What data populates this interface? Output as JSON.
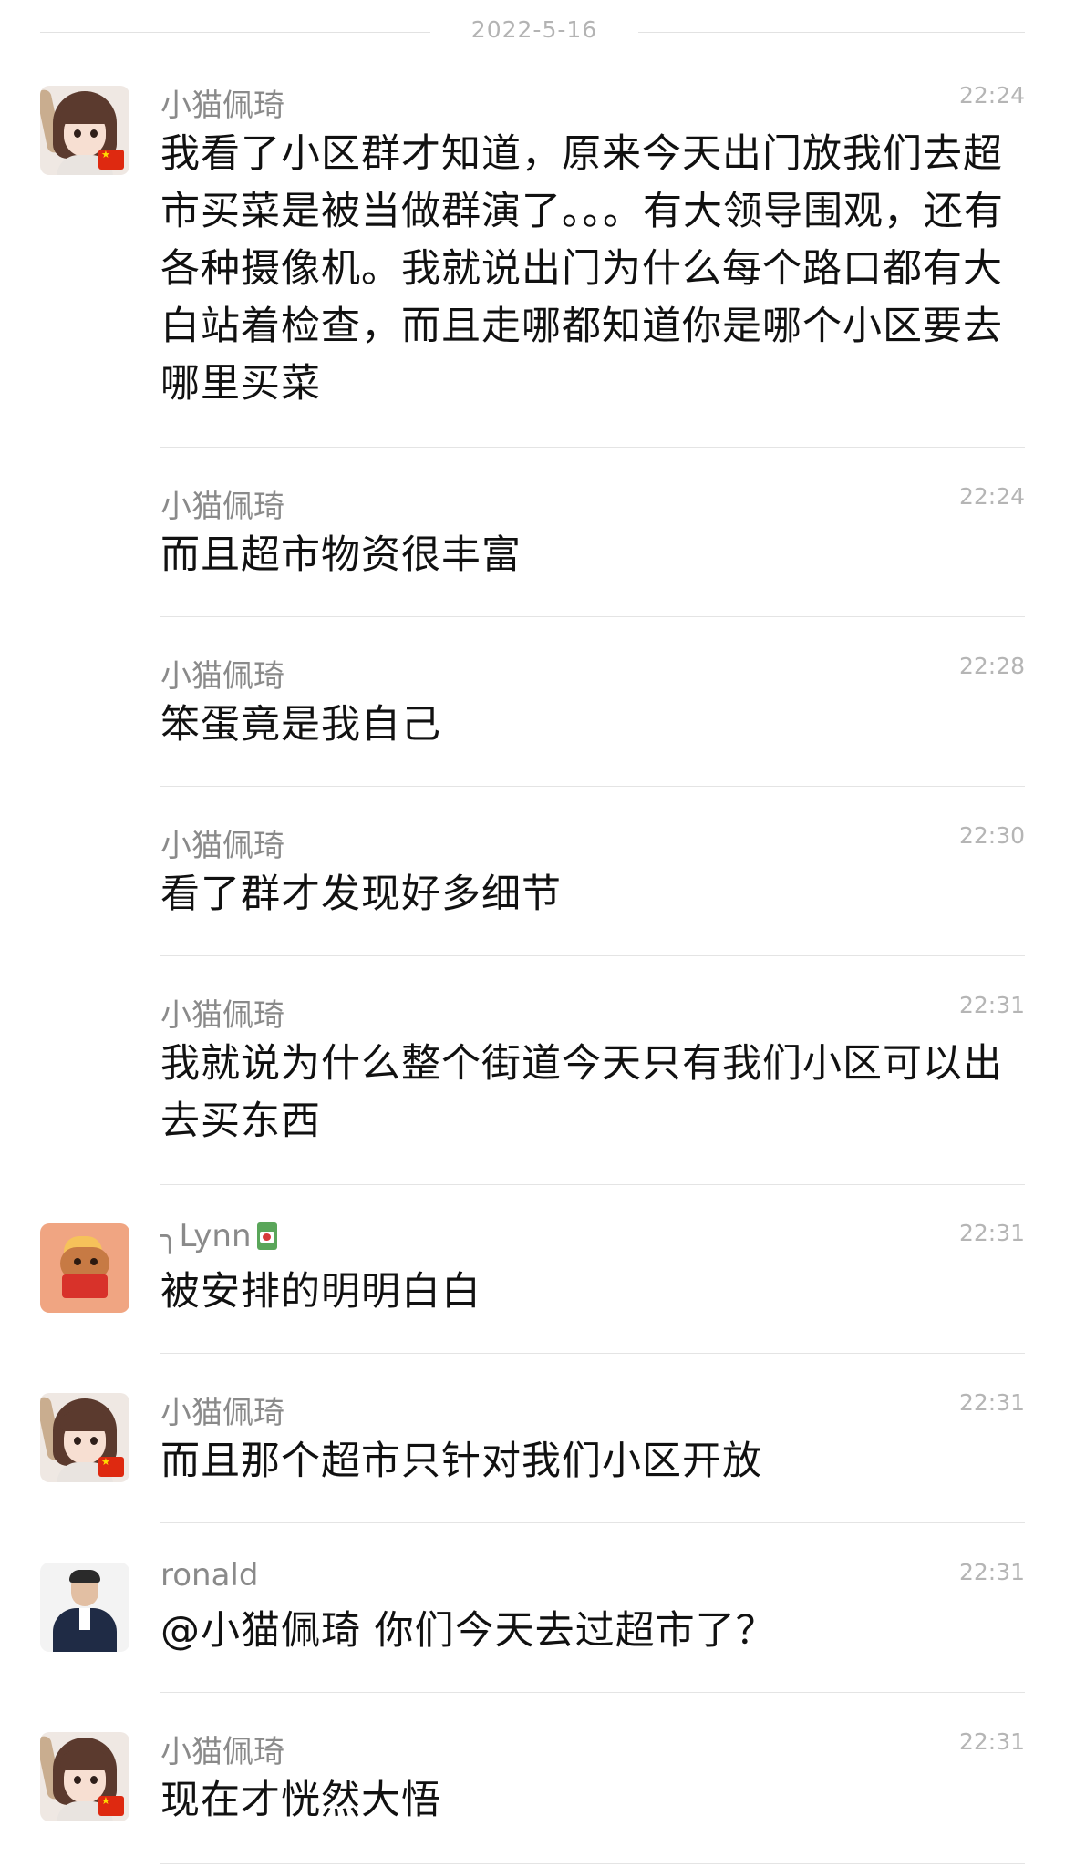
{
  "date_divider": "2022-5-16",
  "messages": [
    {
      "sender": "小猫佩琦",
      "time": "22:24",
      "content": "我看了小区群才知道，原来今天出门放我们去超市买菜是被当做群演了。。。有大领导围观，还有各种摄像机。我就说出门为什么每个路口都有大白站着检查，而且走哪都知道你是哪个小区要去哪里买菜"
    },
    {
      "sender": "小猫佩琦",
      "time": "22:24",
      "content": "而且超市物资很丰富"
    },
    {
      "sender": "小猫佩琦",
      "time": "22:28",
      "content": "笨蛋竟是我自己"
    },
    {
      "sender": "小猫佩琦",
      "time": "22:30",
      "content": "看了群才发现好多细节"
    },
    {
      "sender": "小猫佩琦",
      "time": "22:31",
      "content": "我就说为什么整个街道今天只有我们小区可以出去买东西"
    },
    {
      "sender": "╮Lynn",
      "time": "22:31",
      "content": "被安排的明明白白"
    },
    {
      "sender": "小猫佩琦",
      "time": "22:31",
      "content": "而且那个超市只针对我们小区开放"
    },
    {
      "sender": "ronald",
      "time": "22:31",
      "content": "@小猫佩琦 你们今天去过超市了？"
    },
    {
      "sender": "小猫佩琦",
      "time": "22:31",
      "content": "现在才恍然大悟"
    }
  ]
}
